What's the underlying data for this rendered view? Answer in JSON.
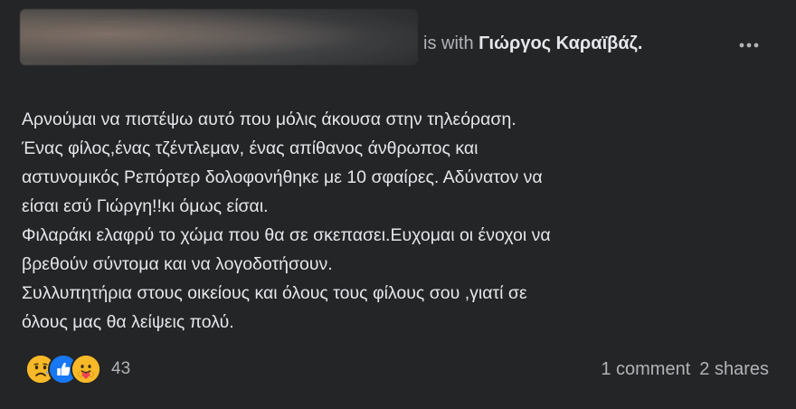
{
  "header": {
    "with_prefix": "is with",
    "with_name": "Γιώργος Καραϊβάζ",
    "with_suffix": ".",
    "more_icon": "ellipsis-horizontal-icon"
  },
  "post": {
    "lines": [
      "Αρνούμαι να πιστέψω αυτό που μόλις άκουσα στην τηλεόραση.",
      "Ένας φίλος,ένας τζέντλεμαν, ένας απίθανος άνθρωπος και",
      "αστυνομικός Ρεπόρτερ δολοφονήθηκε με 10 σφαίρες. Αδύνατον να",
      "είσαι εσύ Γιώργη!!κι όμως είσαι.",
      "Φιλαράκι ελαφρύ το χώμα που θα σε σκεπασει.Ευχομαι οι ένοχοι να",
      "βρεθούν σύντομα και να λογοδοτήσουν.",
      "Συλλυπητήρια στους οικείους και όλους τους φίλους σου ,γιατί σε",
      "όλους μας θα λείψεις πολύ."
    ]
  },
  "footer": {
    "reaction_icons": [
      "sad-reaction-icon",
      "like-reaction-icon",
      "care-reaction-icon"
    ],
    "reaction_count": "43",
    "comments": "1 comment",
    "shares": "2 shares"
  }
}
